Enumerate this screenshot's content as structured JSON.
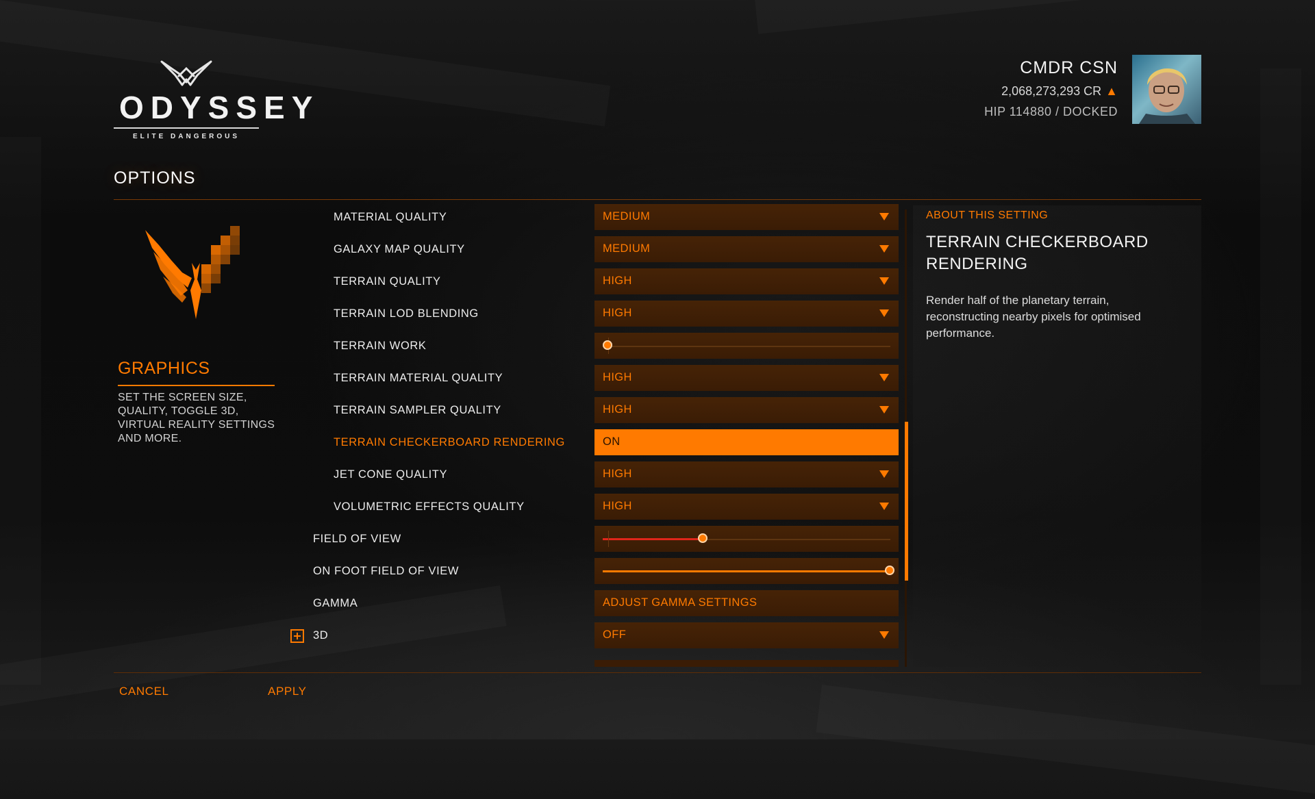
{
  "logo": {
    "title": "ODYSSEY",
    "subtitle": "ELITE DANGEROUS"
  },
  "commander": {
    "name": "CMDR CSN",
    "credits": "2,068,273,293 CR",
    "location": "HIP 114880 / DOCKED"
  },
  "page_title": "OPTIONS",
  "category": {
    "title": "GRAPHICS",
    "description": "SET THE SCREEN SIZE, QUALITY, TOGGLE 3D, VIRTUAL REALITY SETTINGS AND MORE."
  },
  "settings": [
    {
      "label": "MATERIAL QUALITY",
      "value": "MEDIUM"
    },
    {
      "label": "GALAXY MAP QUALITY",
      "value": "MEDIUM"
    },
    {
      "label": "TERRAIN QUALITY",
      "value": "HIGH"
    },
    {
      "label": "TERRAIN LOD BLENDING",
      "value": "HIGH"
    },
    {
      "label": "TERRAIN WORK",
      "slider_fraction": 0.02
    },
    {
      "label": "TERRAIN MATERIAL QUALITY",
      "value": "HIGH"
    },
    {
      "label": "TERRAIN SAMPLER QUALITY",
      "value": "HIGH"
    },
    {
      "label": "TERRAIN CHECKERBOARD RENDERING",
      "value": "ON"
    },
    {
      "label": "JET CONE QUALITY",
      "value": "HIGH"
    },
    {
      "label": "VOLUMETRIC EFFECTS QUALITY",
      "value": "HIGH"
    },
    {
      "label": "FIELD OF VIEW",
      "slider_fraction": 0.35
    },
    {
      "label": "ON FOOT FIELD OF VIEW",
      "slider_fraction": 1.0
    },
    {
      "label": "GAMMA",
      "value": "ADJUST GAMMA SETTINGS"
    },
    {
      "label": "3D",
      "value": "OFF"
    }
  ],
  "about": {
    "label": "ABOUT THIS SETTING",
    "title": "TERRAIN CHECKERBOARD RENDERING",
    "description": "Render half of the planetary terrain, reconstructing nearby pixels for optimised performance."
  },
  "footer": {
    "cancel": "CANCEL",
    "apply": "APPLY"
  },
  "colors": {
    "accent": "#ff7a00",
    "control_bg": "#3a1c05",
    "fov_fill": "#e0261a"
  }
}
